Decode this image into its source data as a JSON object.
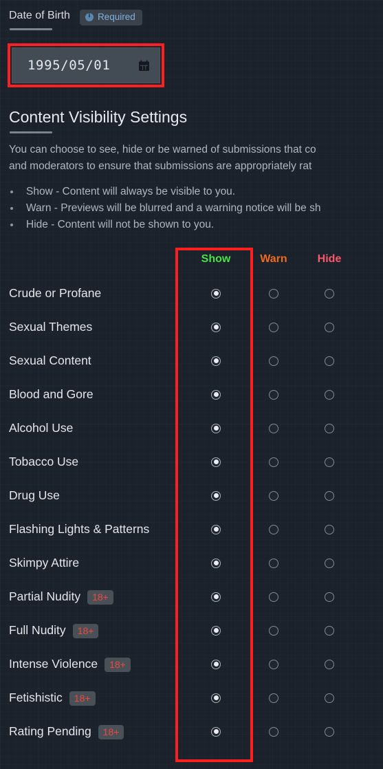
{
  "dob_section": {
    "title": "Date of Birth",
    "required_badge": "Required",
    "info_icon": "info-circle-icon",
    "input_value": "1995/05/01",
    "calendar_icon": "calendar-icon"
  },
  "content_visibility": {
    "title": "Content Visibility Settings",
    "description_line_1": "You can choose to see, hide or be warned of submissions that co",
    "description_line_2": "and moderators to ensure that submissions are appropriately rat",
    "bullets": [
      "Show - Content will always be visible to you.",
      "Warn - Previews will be blurred and a warning notice will be sh",
      "Hide - Content will not be shown to you."
    ],
    "columns": [
      {
        "label": "Show",
        "color": "#4ae14a"
      },
      {
        "label": "Warn",
        "color": "#ef6a1e"
      },
      {
        "label": "Hide",
        "color": "#f9596a"
      }
    ],
    "adult_badge_label": "18+",
    "highlight_color": "#fd2020",
    "rows": [
      {
        "label": "Crude or Profane",
        "adult": false,
        "selected": "Show"
      },
      {
        "label": "Sexual Themes",
        "adult": false,
        "selected": "Show"
      },
      {
        "label": "Sexual Content",
        "adult": false,
        "selected": "Show"
      },
      {
        "label": "Blood and Gore",
        "adult": false,
        "selected": "Show"
      },
      {
        "label": "Alcohol Use",
        "adult": false,
        "selected": "Show"
      },
      {
        "label": "Tobacco Use",
        "adult": false,
        "selected": "Show"
      },
      {
        "label": "Drug Use",
        "adult": false,
        "selected": "Show"
      },
      {
        "label": "Flashing Lights & Patterns",
        "adult": false,
        "selected": "Show"
      },
      {
        "label": "Skimpy Attire",
        "adult": false,
        "selected": "Show"
      },
      {
        "label": "Partial Nudity",
        "adult": true,
        "selected": "Show"
      },
      {
        "label": "Full Nudity",
        "adult": true,
        "selected": "Show"
      },
      {
        "label": "Intense Violence",
        "adult": true,
        "selected": "Show"
      },
      {
        "label": "Fetishistic",
        "adult": true,
        "selected": "Show"
      },
      {
        "label": "Rating Pending",
        "adult": true,
        "selected": "Show"
      }
    ]
  }
}
